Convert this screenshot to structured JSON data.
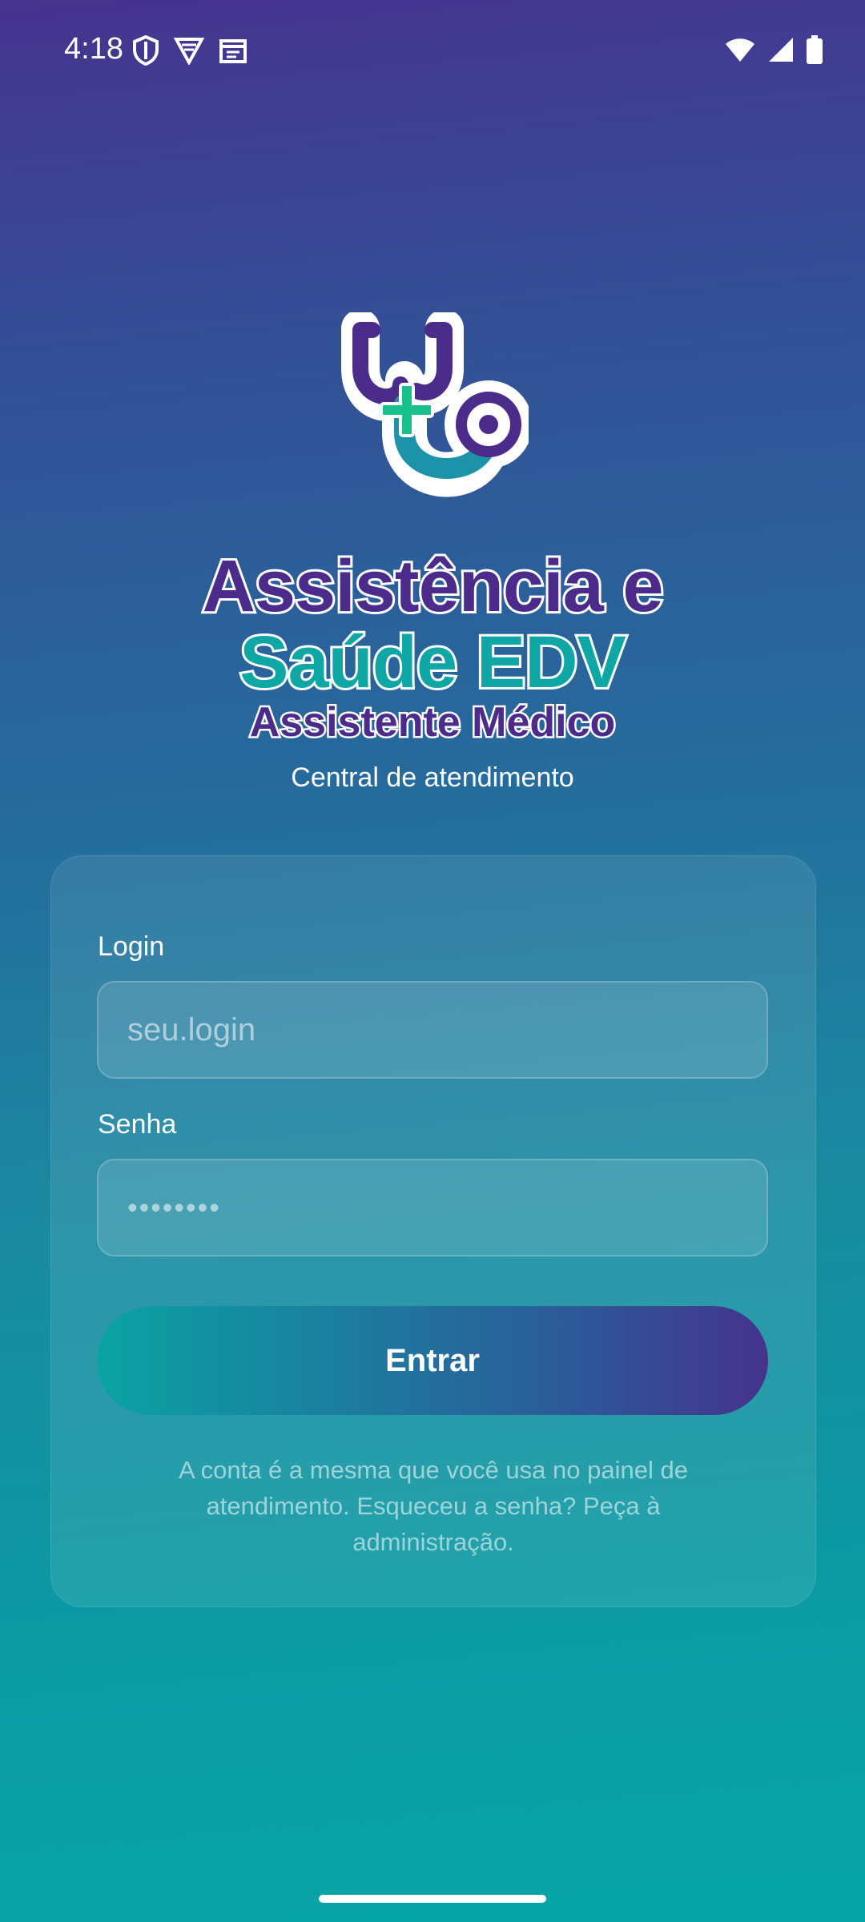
{
  "status_bar": {
    "time": "4:18",
    "left_icons": [
      "shield-icon",
      "vpn-icon",
      "calendar-icon"
    ],
    "right_icons": [
      "wifi-icon",
      "signal-icon",
      "battery-icon"
    ]
  },
  "brand": {
    "line1": "Assistência e",
    "line2": "Saúde EDV",
    "line3": "Assistente Médico",
    "subtitle": "Central de atendimento",
    "colors": {
      "purple": "#4b2c8a",
      "teal": "#0ea7a6",
      "green": "#19c08b"
    }
  },
  "form": {
    "login_label": "Login",
    "login_placeholder": "seu.login",
    "password_label": "Senha",
    "password_value": "••••••••",
    "submit_label": "Entrar",
    "help_text": "A conta é a mesma que você usa no painel de atendimento. Esqueceu a senha? Peça à administração."
  }
}
